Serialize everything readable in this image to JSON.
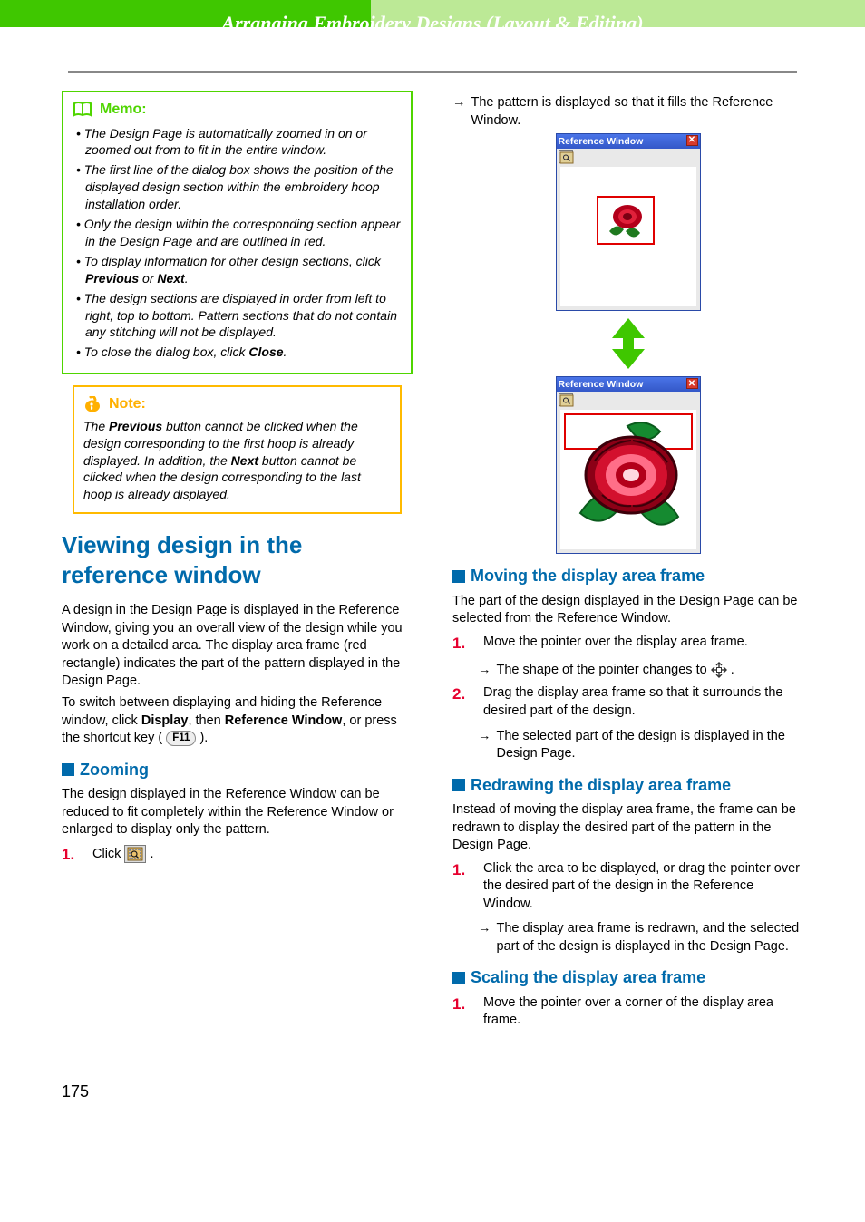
{
  "header": {
    "chapter": "Arranging Embroidery Designs (Layout & Editing)"
  },
  "memo": {
    "label": "Memo:",
    "items": [
      "The Design Page is automatically zoomed in on or zoomed out from to fit in the entire window.",
      "The first line of the dialog box shows the position of the displayed design section within the embroidery hoop installation order.",
      "Only the design within the corresponding section appear in the Design Page and are outlined in red.",
      "To display information for other design sections, click Previous or Next.",
      "The design sections are displayed in order from left to right, top to bottom. Pattern sections that do not contain any stitching will not be displayed.",
      "To close the dialog box, click Close."
    ],
    "bold": {
      "3": [
        "Previous",
        "Next"
      ],
      "5": [
        "Close"
      ]
    }
  },
  "note": {
    "label": "Note:",
    "body": "The Previous button cannot be clicked when the design corresponding to the first hoop is already displayed. In addition, the Next button cannot be clicked when the design corresponding to the last hoop is already displayed.",
    "bold": [
      "Previous",
      "Next"
    ]
  },
  "h1": "Viewing design in the reference window",
  "intro_a": "A design in the Design Page is displayed in the Reference Window, giving you an overall view of the design while you work on a detailed area. The display area frame (red rectangle) indicates the part of the pattern displayed in the Design Page.",
  "intro_b_pre": "To switch between displaying and hiding the Reference window, click ",
  "intro_b_b1": "Display",
  "intro_b_mid": ", then ",
  "intro_b_b2": "Reference Window",
  "intro_b_post": ", or press the shortcut key ( ",
  "intro_b_key": "F11",
  "intro_b_end": " ).",
  "sec_zoom": "Zooming",
  "zoom_body": "The design displayed in the Reference Window can be reduced to fit completely within the Reference Window or enlarged to display only the pattern.",
  "zoom_step1_pre": "Click ",
  "zoom_step1_post": " .",
  "result_top": "The pattern is displayed so that it fills the Reference Window.",
  "refwin_title": "Reference Window",
  "sec_move": "Moving the display area frame",
  "move_body": "The part of the design displayed in the Design Page can be selected from the Reference Window.",
  "move_step1": "Move the pointer over the display area frame.",
  "move_step1_res_pre": "The shape of the pointer changes to ",
  "move_step1_res_post": " .",
  "move_step2": "Drag the display area frame so that it surrounds the desired part of the design.",
  "move_step2_res": "The selected part of the design is displayed in the Design Page.",
  "sec_redraw": "Redrawing the display area frame",
  "redraw_body": "Instead of moving the display area frame, the frame can be redrawn to display the desired part of the pattern in the Design Page.",
  "redraw_step1": "Click the area to be displayed, or drag the pointer over the desired part of the design in the Reference Window.",
  "redraw_step1_res": "The display area frame is redrawn, and the selected part of the design is displayed in the Design Page.",
  "sec_scale": "Scaling the display area frame",
  "scale_step1": "Move the pointer over a corner of the display area frame.",
  "page_number": "175"
}
